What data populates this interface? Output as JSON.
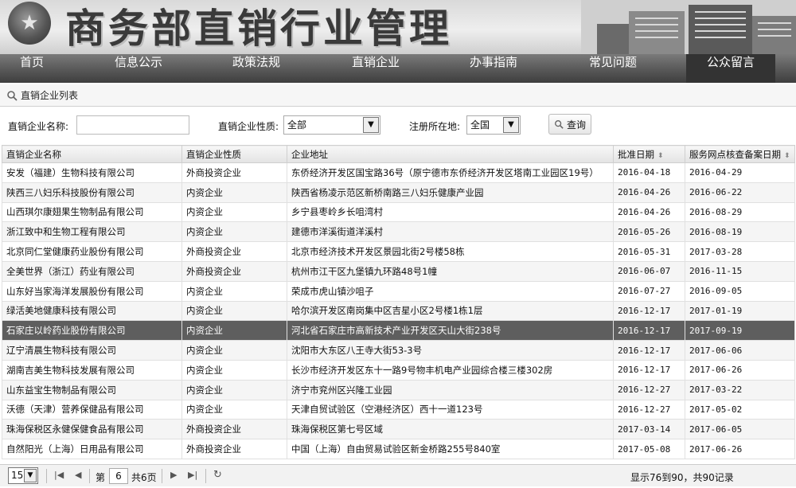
{
  "header": {
    "title": "商务部直销行业管理",
    "nav": [
      "首页",
      "信息公示",
      "政策法规",
      "直销企业",
      "办事指南",
      "常见问题",
      "公众留言"
    ]
  },
  "panel": {
    "title": "直销企业列表"
  },
  "filters": {
    "name_label": "直销企业名称:",
    "name_value": "",
    "type_label": "直销企业性质:",
    "type_value": "全部",
    "region_label": "注册所在地:",
    "region_value": "全国",
    "query_label": "查询"
  },
  "table": {
    "headers": [
      "直销企业名称",
      "直销企业性质",
      "企业地址",
      "批准日期",
      "服务网点核查备案日期"
    ],
    "rows": [
      [
        "安发（福建）生物科技有限公司",
        "外商投资企业",
        "东侨经济开发区国宝路36号（原宁德市东侨经济开发区塔南工业园区19号）",
        "2016-04-18",
        "2016-04-29"
      ],
      [
        "陕西三八妇乐科技股份有限公司",
        "内资企业",
        "陕西省杨凌示范区新桥南路三八妇乐健康产业园",
        "2016-04-26",
        "2016-06-22"
      ],
      [
        "山西琪尔康翅果生物制品有限公司",
        "内资企业",
        "乡宁县枣岭乡长咀湾村",
        "2016-04-26",
        "2016-08-29"
      ],
      [
        "浙江致中和生物工程有限公司",
        "内资企业",
        "建德市洋溪街道洋溪村",
        "2016-05-26",
        "2016-08-19"
      ],
      [
        "北京同仁堂健康药业股份有限公司",
        "外商投资企业",
        "北京市经济技术开发区景园北街2号楼58栋",
        "2016-05-31",
        "2017-03-28"
      ],
      [
        "全美世界（浙江）药业有限公司",
        "外商投资企业",
        "杭州市江干区九堡镇九环路48号1幢",
        "2016-06-07",
        "2016-11-15"
      ],
      [
        "山东好当家海洋发展股份有限公司",
        "内资企业",
        "荣成市虎山镇沙咀子",
        "2016-07-27",
        "2016-09-05"
      ],
      [
        "绿活美地健康科技有限公司",
        "内资企业",
        "哈尔滨开发区南岗集中区吉星小区2号楼1栋1层",
        "2016-12-17",
        "2017-01-19"
      ],
      [
        "石家庄以岭药业股份有限公司",
        "内资企业",
        "河北省石家庄市高新技术产业开发区天山大街238号",
        "2016-12-17",
        "2017-09-19"
      ],
      [
        "辽宁清晨生物科技有限公司",
        "内资企业",
        "沈阳市大东区八王寺大街53-3号",
        "2016-12-17",
        "2017-06-06"
      ],
      [
        "湖南吉美生物科技发展有限公司",
        "内资企业",
        "长沙市经济开发区东十一路9号物丰机电产业园综合楼三楼302房",
        "2016-12-17",
        "2017-06-26"
      ],
      [
        "山东益宝生物制品有限公司",
        "内资企业",
        "济宁市兖州区兴隆工业园",
        "2016-12-27",
        "2017-03-22"
      ],
      [
        "沃德（天津）营养保健品有限公司",
        "内资企业",
        "天津自贸试验区（空港经济区）西十一道123号",
        "2016-12-27",
        "2017-05-02"
      ],
      [
        "珠海保税区永健保健食品有限公司",
        "外商投资企业",
        "珠海保税区第七号区域",
        "2017-03-14",
        "2017-06-05"
      ],
      [
        "自然阳光（上海）日用品有限公司",
        "外商投资企业",
        "中国（上海）自由贸易试验区新金桥路255号840室",
        "2017-05-08",
        "2017-06-26"
      ]
    ],
    "selected_row": 8
  },
  "pager": {
    "page_size": "15",
    "page_prefix": "第",
    "page_value": "6",
    "page_suffix": "共6页",
    "summary": "显示76到90，共90记录"
  }
}
